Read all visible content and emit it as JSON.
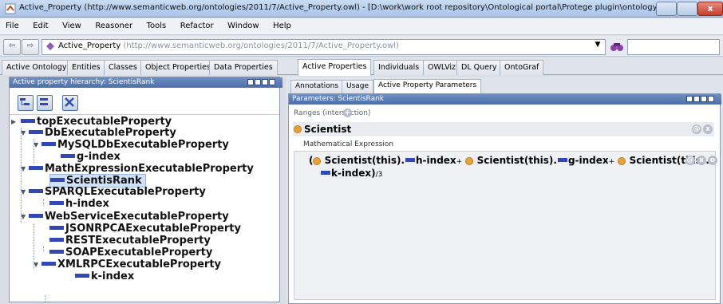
{
  "window": {
    "title": "Active_Property (http://www.semanticweb.org/ontologies/2011/7/Active_Property.owl) - [D:\\work\\work root repository\\Ontological portal\\Protege plugin\\ontology\\Active...",
    "close_glyph": "x",
    "accent_color": "#4c6ea8"
  },
  "menu": [
    "File",
    "Edit",
    "View",
    "Reasoner",
    "Tools",
    "Refactor",
    "Window",
    "Help"
  ],
  "toolbar": {
    "back_glyph": "⇦",
    "forward_glyph": "⇨",
    "ontology_name": "Active_Property",
    "ontology_url": "(http://www.semanticweb.org/ontologies/2011/7/Active_Property.owl)",
    "dropdown_glyph": "▼",
    "search_value": ""
  },
  "tabs": [
    "Active Ontology",
    "Entities",
    "Classes",
    "Object Properties",
    "Data Properties",
    "Active Properties",
    "Individuals",
    "OWLViz",
    "DL Query",
    "OntoGraf"
  ],
  "active_tab": "Active Properties",
  "left_panel": {
    "header": "Active property hierarchy: ScientisRank",
    "tree": [
      {
        "label": "topExecutableProperty",
        "toggle": "▶"
      },
      {
        "label": "DbExecutableProperty",
        "toggle": "▼"
      },
      {
        "label": "MySQLDbExecutableProperty",
        "toggle": "▼"
      },
      {
        "label": "g-index",
        "toggle": ""
      },
      {
        "label": "MathExpressionExecutableProperty",
        "toggle": "▼"
      },
      {
        "label": "ScientisRank",
        "toggle": "",
        "selected": true
      },
      {
        "label": "SPARQLExecutableProperty",
        "toggle": "▼"
      },
      {
        "label": "h-index",
        "toggle": ""
      },
      {
        "label": "WebServiceExecutableProperty",
        "toggle": "▼"
      },
      {
        "label": "JSONRPCAExecutableProperty",
        "toggle": ""
      },
      {
        "label": "RESTExecutableProperty",
        "toggle": ""
      },
      {
        "label": "SOAPExecutableProperty",
        "toggle": ""
      },
      {
        "label": "XMLRPCExecutableProperty",
        "toggle": "▼"
      },
      {
        "label": "k-index",
        "toggle": ""
      }
    ]
  },
  "right_panel": {
    "sub_tabs": [
      "Annotations",
      "Usage",
      "Active Property Parameters"
    ],
    "active_sub_tab": "Active Property Parameters",
    "params_header": "Parameters: ScientisRank",
    "ranges_label": "Ranges (intersection)",
    "add_glyph": "+",
    "range_class": "Scientist",
    "math_label": "Mathematical Expression",
    "expression": {
      "open_paren": "(",
      "term1_class": "Scientist(this).",
      "term1_prop": "h-index",
      "plus": "+",
      "term2_class": "Scientist(this).",
      "term2_prop": "g-index",
      "term3_class": "Scientist(this).",
      "term3_prop": "k-index)",
      "divisor": "/3"
    },
    "row_button_glyphs": [
      "@",
      "x",
      "o"
    ]
  }
}
